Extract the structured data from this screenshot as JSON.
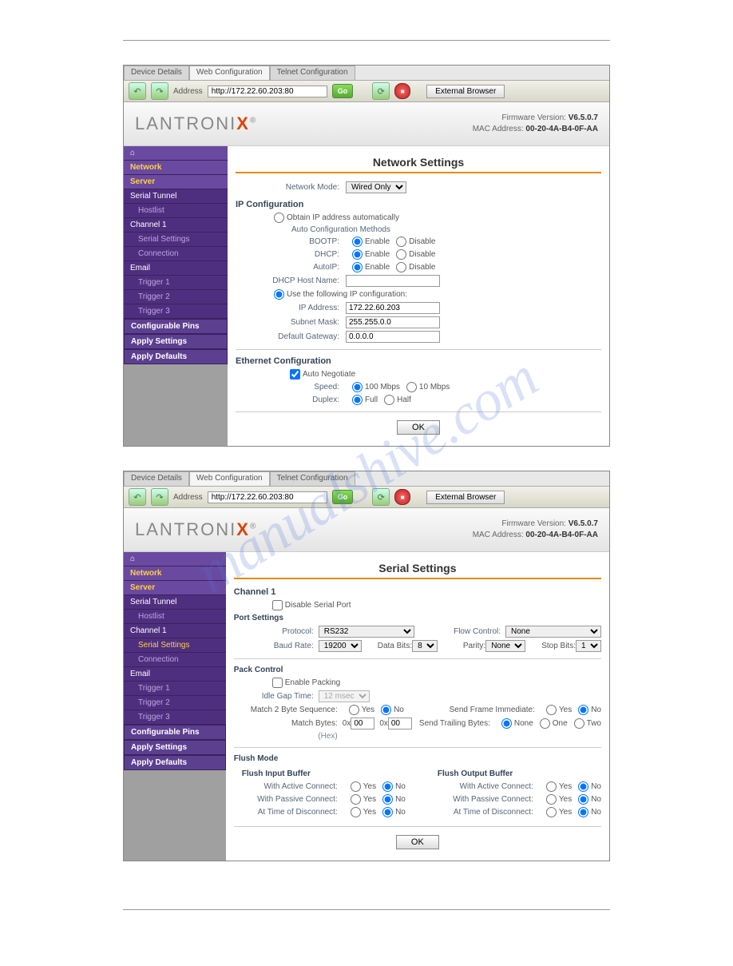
{
  "watermark": "manualshive.com",
  "tabs": {
    "t1": "Device Details",
    "t2": "Web Configuration",
    "t3": "Telnet Configuration"
  },
  "toolbar": {
    "addr_label": "Address",
    "addr_value": "http://172.22.60.203:80",
    "go": "Go",
    "ext": "External Browser"
  },
  "logo": {
    "pre": "LANTRONI",
    "x": "X",
    "tm": "®"
  },
  "fw": {
    "label": "Firmware Version:",
    "value": "V6.5.0.7",
    "mac_label": "MAC Address:",
    "mac_value": "00-20-4A-B4-0F-AA"
  },
  "side": {
    "home": "⌂",
    "network": "Network",
    "server": "Server",
    "serial_tunnel": "Serial Tunnel",
    "hostlist": "Hostlist",
    "channel1": "Channel 1",
    "serial_settings": "Serial Settings",
    "connection": "Connection",
    "email": "Email",
    "trig1": "Trigger 1",
    "trig2": "Trigger 2",
    "trig3": "Trigger 3",
    "cfg_pins": "Configurable Pins",
    "apply_settings": "Apply Settings",
    "apply_defaults": "Apply Defaults"
  },
  "net": {
    "title": "Network Settings",
    "mode_label": "Network Mode:",
    "mode_value": "Wired Only",
    "ipcfg": "IP Configuration",
    "auto_label": "Obtain IP address automatically",
    "auto_methods": "Auto Configuration Methods",
    "bootp": "BOOTP:",
    "dhcp": "DHCP:",
    "autoip": "AutoIP:",
    "enable": "Enable",
    "disable": "Disable",
    "dhcp_host": "DHCP Host Name:",
    "use_following": "Use the following IP configuration:",
    "ip_label": "IP Address:",
    "ip_value": "172.22.60.203",
    "mask_label": "Subnet Mask:",
    "mask_value": "255.255.0.0",
    "gw_label": "Default Gateway:",
    "gw_value": "0.0.0.0",
    "ethcfg": "Ethernet Configuration",
    "autoneg": "Auto Negotiate",
    "speed": "Speed:",
    "s100": "100 Mbps",
    "s10": "10 Mbps",
    "duplex": "Duplex:",
    "full": "Full",
    "half": "Half",
    "ok": "OK"
  },
  "ser": {
    "title": "Serial Settings",
    "channel": "Channel 1",
    "disable_port": "Disable Serial Port",
    "port_settings": "Port Settings",
    "protocol": "Protocol:",
    "protocol_value": "RS232",
    "flow": "Flow Control:",
    "flow_value": "None",
    "baud": "Baud Rate:",
    "baud_value": "19200",
    "data_bits": "Data Bits:",
    "data_bits_value": "8",
    "parity": "Parity:",
    "parity_value": "None",
    "stop_bits": "Stop Bits:",
    "stop_bits_value": "1",
    "pack_control": "Pack Control",
    "enable_packing": "Enable Packing",
    "idle_gap": "Idle Gap Time:",
    "idle_gap_value": "12 msec",
    "match2byte": "Match 2 Byte Sequence:",
    "send_frame": "Send Frame Immediate:",
    "match_bytes": "Match Bytes:",
    "hex": "(Hex)",
    "ox": "0x",
    "send_trailing": "Send Trailing Bytes:",
    "none": "None",
    "one": "One",
    "two": "Two",
    "yes": "Yes",
    "no": "No",
    "flush_mode": "Flush Mode",
    "flush_in": "Flush Input Buffer",
    "flush_out": "Flush Output Buffer",
    "active": "With Active Connect:",
    "passive": "With Passive Connect:",
    "disc": "At Time of Disconnect:",
    "ok": "OK"
  }
}
